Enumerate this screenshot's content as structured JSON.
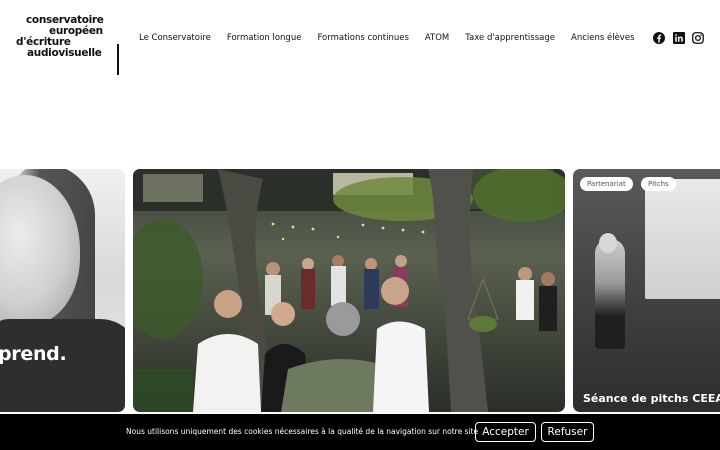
{
  "logo": {
    "lines": [
      "conservatoire",
      "européen",
      "d'écriture",
      "audiovisuelle"
    ]
  },
  "nav": {
    "items": [
      "Le Conservatoire",
      "Formation longue",
      "Formations continues",
      "ATOM",
      "Taxe d'apprentissage",
      "Anciens élèves"
    ]
  },
  "social": [
    "facebook-icon",
    "linkedin-icon",
    "instagram-icon"
  ],
  "carousel": {
    "left_caption": "prend.",
    "right_tags": [
      "Partenariat",
      "Pitchs"
    ],
    "right_caption": "Séance de pitchs CEEA x S"
  },
  "cookie": {
    "message": "Nous utilisons uniquement des cookies nécessaires à la qualité de la navigation sur notre site",
    "accept_label": "Accepter",
    "refuse_label": "Refuser"
  }
}
